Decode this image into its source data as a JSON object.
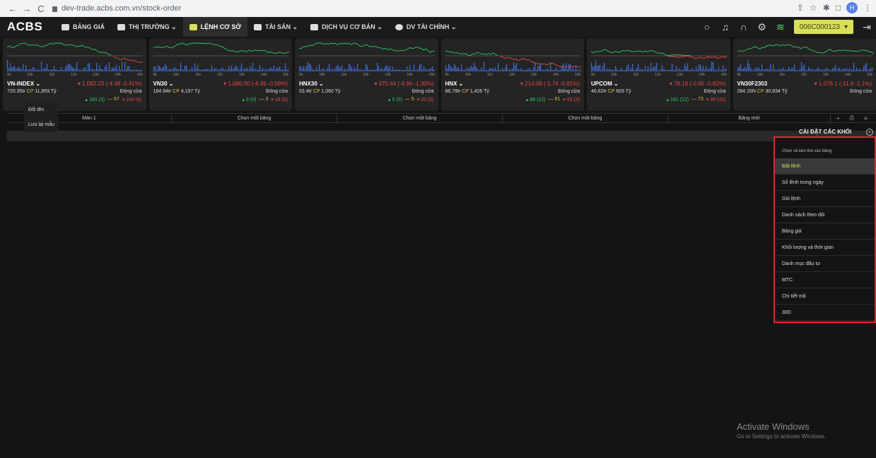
{
  "browser": {
    "back": "←",
    "forward": "→",
    "reload": "C",
    "url": "dev-trade.acbs.com.vn/stock-order",
    "profile": "H"
  },
  "app": {
    "logo": "ACBS"
  },
  "menu": [
    {
      "label": "BẢNG GIÁ"
    },
    {
      "label": "THỊ TRƯỜNG ⌄"
    },
    {
      "label": "LỆNH CƠ SỞ"
    },
    {
      "label": "TÀI SẢN ⌄"
    },
    {
      "label": "DỊCH VỤ CƠ BẢN ⌄"
    },
    {
      "label": "DV TÀI CHÍNH ⌄"
    }
  ],
  "account": {
    "label": "006C000123",
    "chevron": "▾"
  },
  "time_ticks": [
    "9h",
    "10h",
    "11h",
    "12h",
    "13h",
    "14h",
    "15h"
  ],
  "cards": [
    {
      "name": "VN-INDEX ⌄",
      "change": "▾ 1,082.23 (-4.48 -0.41%)",
      "vol": "720.35tr",
      "value": "11,859 Tỷ",
      "status": "Đóng cửa",
      "up": "▴ 183 (3)",
      "flat": "— 67",
      "down": "▾ 234 (6)"
    },
    {
      "name": "VN30 ⌄",
      "change": "▾ 1,080.90 (-6.46 -0.59%)",
      "vol": "184.94tr",
      "value": "4,197 Tỷ",
      "status": "Đóng cửa",
      "up": "▴ 9 (0)",
      "flat": "— 3",
      "down": "▾ 18 (0)"
    },
    {
      "name": "HNX30 ⌄",
      "change": "▾ 375.64 (-4.96 -1.30%)",
      "vol": "53.4tr",
      "value": "1,060 Tỷ",
      "status": "Đóng cửa",
      "up": "▴ 5 (0)",
      "flat": "— 5",
      "down": "▾ 20 (0)"
    },
    {
      "name": "HNX ⌄",
      "change": "▾ 214.08 (-1.74 -0.81%)",
      "vol": "86.79tr",
      "value": "1,426 Tỷ",
      "status": "Đóng cửa",
      "up": "▴ 86 (12)",
      "flat": "— 61",
      "down": "▾ 93 (3)"
    },
    {
      "name": "UPCOM ⌄",
      "change": "▾ 78.18 (-0.65 -0.82%)",
      "vol": "46.62tr",
      "value": "603 Tỷ",
      "status": "Đóng cửa",
      "up": "▴ 161 (12)",
      "flat": "— 73",
      "down": "▾ 99 (10)"
    },
    {
      "name": "VN30F2303",
      "change": "▾ 1,076.1 (-11.9 -1.1%)",
      "vol": "284.16N",
      "value": "30,834 Tỷ",
      "status": "Đóng cửa",
      "up": "",
      "flat": "",
      "down": ""
    }
  ],
  "cp_label": "CP",
  "tabs": [
    "Màn 1",
    "Chọn một bảng",
    "Chọn một bảng",
    "Chọn một bảng",
    "Bảng mới"
  ],
  "tab_tools": {
    "add": "+",
    "print": "⎙",
    "more": "≡"
  },
  "context_menu": [
    "Đổi tên",
    "Lưu lại mẫu"
  ],
  "settings": {
    "title": "CÀI ĐẶT CÁC KHỐI",
    "close": "×",
    "hint": "Chọn và kéo thả vào bảng",
    "items": [
      "Đặt lệnh",
      "Sổ lệnh trong ngày",
      "Giỏ lệnh",
      "Danh sách theo dõi",
      "Bảng giá",
      "Khối lượng và thời gian",
      "Danh mục đầu tư",
      "MTC",
      "Chi tiết mã",
      "30D"
    ],
    "active_index": 0
  },
  "watermark": {
    "title": "Activate Windows",
    "subtitle": "Go to Settings to activate Windows."
  },
  "colors": {
    "accent": "#d8e05a",
    "down": "#e84545",
    "up": "#2ec76a",
    "flat": "#d8c04a",
    "highlight_border": "#e0282e"
  }
}
